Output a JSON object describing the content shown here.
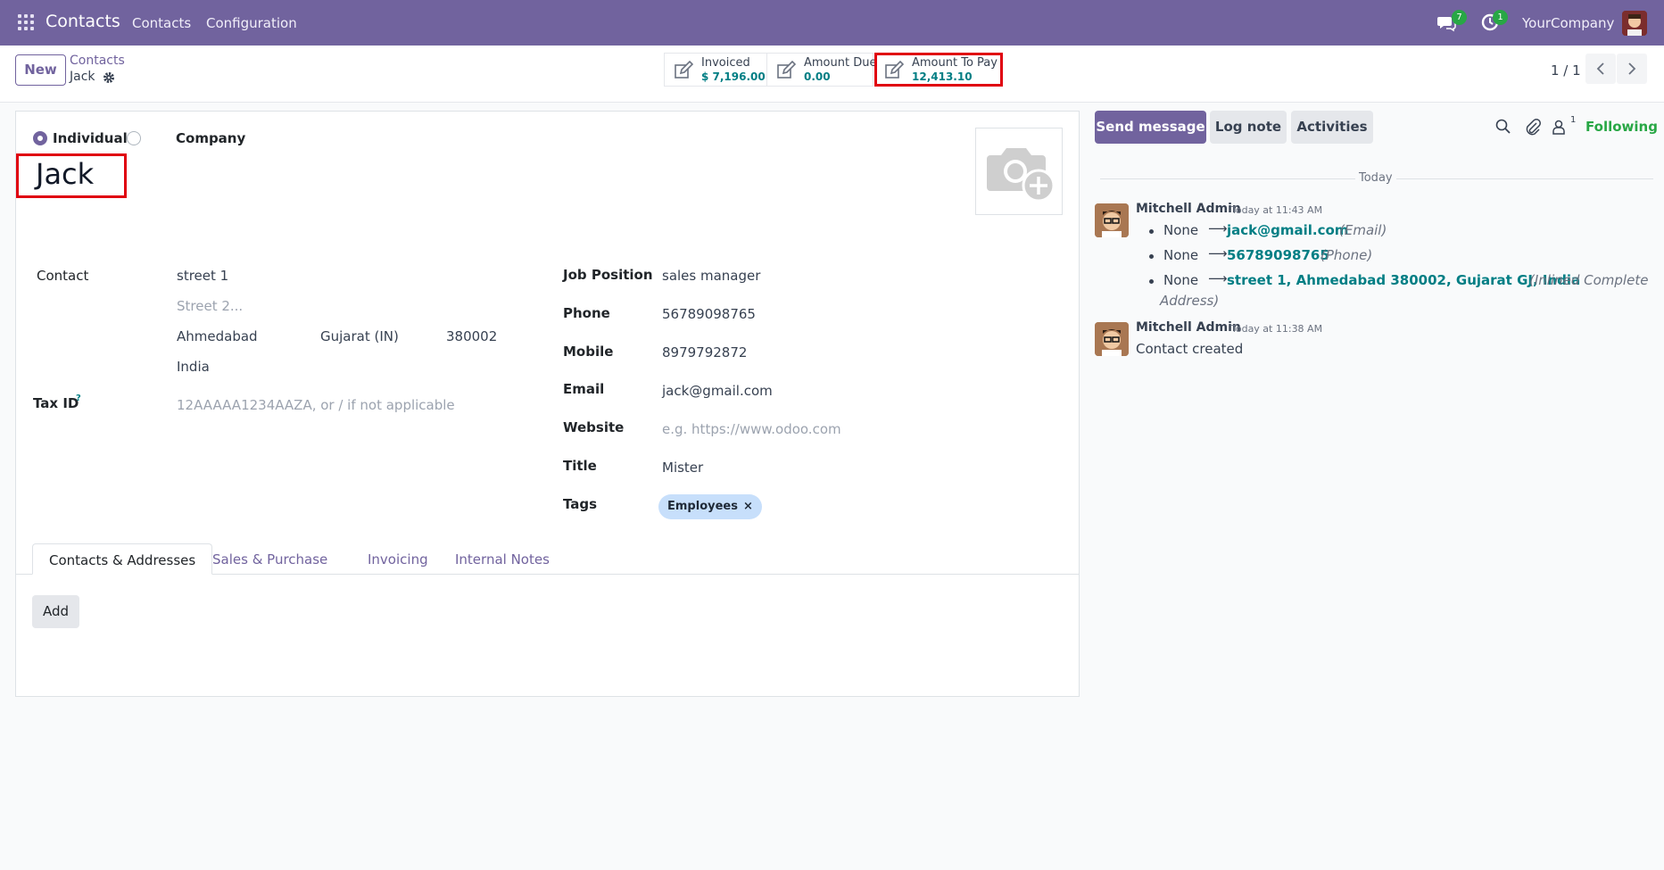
{
  "nav": {
    "app_name": "Contacts",
    "menu": [
      "Contacts",
      "Configuration"
    ],
    "messages_count": "7",
    "activities_count": "1",
    "company": "YourCompany"
  },
  "control": {
    "new_label": "New",
    "breadcrumb_parent": "Contacts",
    "breadcrumb_current": "Jack",
    "stats": [
      {
        "label": "Invoiced",
        "value": "$ 7,196.00"
      },
      {
        "label": "Amount Due",
        "value": "0.00"
      },
      {
        "label": "Amount To Pay",
        "value": "12,413.10"
      }
    ],
    "pager": "1 / 1"
  },
  "form": {
    "type_individual": "Individual",
    "type_company": "Company",
    "name": "Jack",
    "contact_label": "Contact",
    "street": "street 1",
    "street2_placeholder": "Street 2...",
    "city": "Ahmedabad",
    "state": "Gujarat (IN)",
    "zip": "380002",
    "country": "India",
    "tax_label": "Tax ID",
    "tax_help": "?",
    "tax_placeholder": "12AAAAA1234AAZA, or / if not applicable",
    "job_label": "Job Position",
    "job": "sales manager",
    "phone_label": "Phone",
    "phone": "56789098765",
    "mobile_label": "Mobile",
    "mobile": "8979792872",
    "email_label": "Email",
    "email": "jack@gmail.com",
    "website_label": "Website",
    "website_placeholder": "e.g. https://www.odoo.com",
    "title_label": "Title",
    "title": "Mister",
    "tags_label": "Tags",
    "tag": "Employees",
    "tag_remove": "×",
    "tabs": [
      "Contacts & Addresses",
      "Sales & Purchase",
      "Invoicing",
      "Internal Notes"
    ],
    "add_label": "Add"
  },
  "chatter": {
    "send_message": "Send message",
    "log_note": "Log note",
    "activities": "Activities",
    "followers_count": "1",
    "following": "Following",
    "date_separator": "Today",
    "messages": [
      {
        "author": "Mitchell Admin",
        "time": "Today at 11:43 AM",
        "changes": [
          {
            "old": "None",
            "new": "jack@gmail.com",
            "field": "(Email)"
          },
          {
            "old": "None",
            "new": "56789098765",
            "field": "(Phone)"
          },
          {
            "old": "None",
            "new": "street 1, Ahmedabad 380002, Gujarat GJ, India",
            "field": "(Inlined Complete",
            "field_cont": "Address)"
          }
        ]
      },
      {
        "author": "Mitchell Admin",
        "time": "Today at 11:38 AM",
        "body": "Contact created"
      }
    ]
  }
}
